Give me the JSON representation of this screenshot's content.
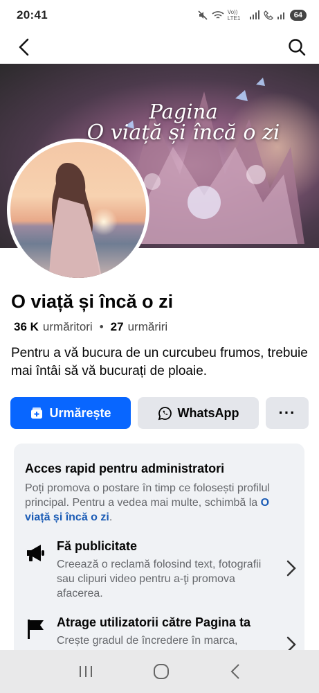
{
  "status": {
    "time": "20:41",
    "volte": "Vo)) LTE1",
    "battery": "64"
  },
  "nav": {
    "back_icon": "back-arrow-icon",
    "search_icon": "search-icon"
  },
  "cover": {
    "title_line1": "Pagina",
    "title_line2": "O viață și încă o zi"
  },
  "page": {
    "name": "O viață și încă o zi",
    "followers_count": "36 K",
    "followers_label": "urmăritori",
    "separator": "•",
    "following_count": "27",
    "following_label": "urmăriri",
    "bio": "Pentru a vă bucura de un curcubeu frumos, trebuie mai întâi să vă bucurați de ploaie."
  },
  "actions": {
    "follow_label": "Urmărește",
    "whatsapp_label": "WhatsApp",
    "more_label": "···"
  },
  "admin": {
    "title": "Acces rapid pentru administratori",
    "desc_prefix": "Poți promova o postare în timp ce folosești profilul principal. Pentru a vedea mai multe, schimbă la ",
    "desc_link": "O viață și încă o zi",
    "desc_suffix": ".",
    "items": [
      {
        "title": "Fă publicitate",
        "desc": "Creează o reclamă folosind text, fotografii sau clipuri video pentru a-ţi promova afacerea.",
        "icon": "megaphone-icon"
      },
      {
        "title": "Atrage utilizatorii către Pagina ta",
        "desc": "Crește gradul de încredere în marca, ",
        "icon": "flag-icon"
      }
    ]
  },
  "colors": {
    "primary": "#0866ff",
    "secondary_button": "#e4e6eb",
    "card_bg": "#f0f2f5",
    "link": "#1a5bb5"
  }
}
